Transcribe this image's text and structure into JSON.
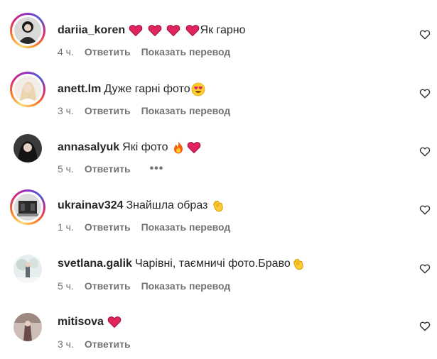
{
  "comments": [
    {
      "username": "dariia_koren",
      "text": "Як гарно",
      "emojis": [
        "red-heart",
        "red-heart",
        "red-heart",
        "red-heart"
      ],
      "emoji_position": "before",
      "time": "4 ч.",
      "reply_label": "Ответить",
      "translate_label": "Показать перевод",
      "has_story": true
    },
    {
      "username": "anett.lm",
      "text": "Дуже гарні фото",
      "emojis": [
        "heart-eyes"
      ],
      "emoji_position": "after",
      "time": "3 ч.",
      "reply_label": "Ответить",
      "translate_label": "Показать перевод",
      "has_story": true
    },
    {
      "username": "annasalyuk",
      "text": "Які фото",
      "emojis": [
        "fire",
        "red-heart"
      ],
      "emoji_position": "after",
      "time": "5 ч.",
      "reply_label": "Ответить",
      "more_label": "•••",
      "has_story": false
    },
    {
      "username": "ukrainav324",
      "text": "Знайшла образ",
      "emojis": [
        "clapping-hands"
      ],
      "emoji_position": "after",
      "time": "1 ч.",
      "reply_label": "Ответить",
      "translate_label": "Показать перевод",
      "has_story": true
    },
    {
      "username": "svetlana.galik",
      "text": "Чарівні, таємничі фото.Браво",
      "emojis": [
        "clapping-hands"
      ],
      "emoji_position": "after",
      "time": "5 ч.",
      "reply_label": "Ответить",
      "translate_label": "Показать перевод",
      "has_story": false
    },
    {
      "username": "mitisova",
      "text": "",
      "emojis": [
        "red-heart"
      ],
      "emoji_position": "after",
      "time": "3 ч.",
      "reply_label": "Ответить",
      "has_story": false
    }
  ],
  "colors": {
    "text": "#262626",
    "secondary": "#737373",
    "heart": "#e0245e"
  }
}
